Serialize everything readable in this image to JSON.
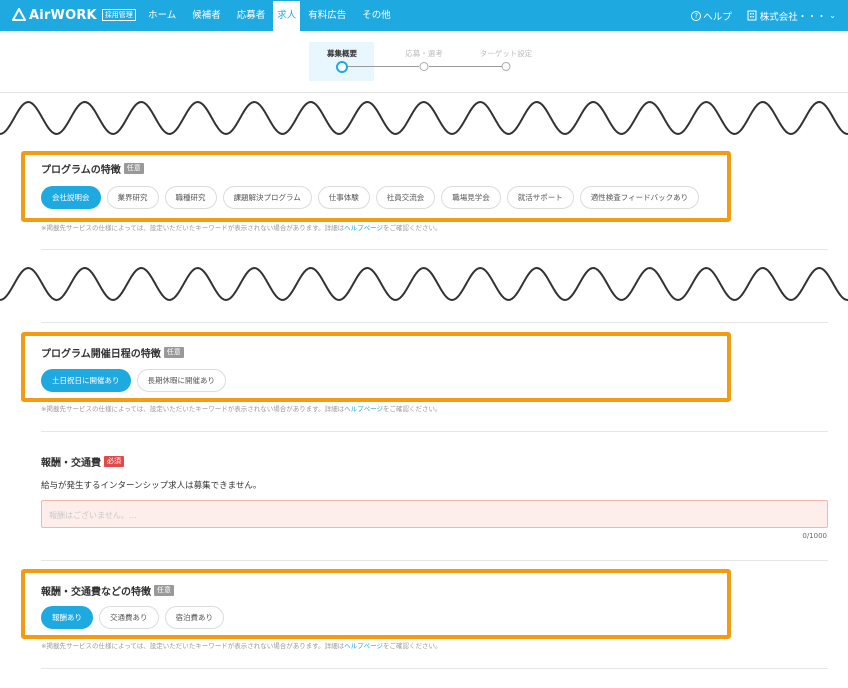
{
  "header": {
    "logo_text": "AirWORK",
    "logo_badge": "採用管理",
    "nav": [
      "ホーム",
      "候補者",
      "応募者",
      "求人",
      "有料広告",
      "その他"
    ],
    "active_nav": "求人",
    "help": "ヘルプ",
    "company": "株式会社・・・",
    "color": "#1fa9e1"
  },
  "stepper": {
    "steps": [
      "募集概要",
      "応募・選考",
      "ターゲット設定"
    ],
    "current": "募集概要"
  },
  "sections": {
    "program_features": {
      "title": "プログラムの特徴",
      "tag": "任意",
      "chips": [
        "会社説明会",
        "業界研究",
        "職種研究",
        "課題解決プログラム",
        "仕事体験",
        "社員交流会",
        "職場見学会",
        "就活サポート",
        "適性検査フィードバックあり"
      ],
      "selected": "会社説明会",
      "note": "※掲載先サービスの仕様によっては、設定いただいたキーワードが表示されない場合があります。詳細は",
      "note_link": "ヘルプページ",
      "note_tail": "をご確認ください。"
    },
    "schedule_features": {
      "title": "プログラム開催日程の特徴",
      "tag": "任意",
      "chips": [
        "土日祝日に開催あり",
        "長期休暇に開催あり"
      ],
      "selected": "土日祝日に開催あり",
      "note": "※掲載先サービスの仕様によっては、設定いただいたキーワードが表示されない場合があります。詳細は",
      "note_link": "ヘルプページ",
      "note_tail": "をご確認ください。"
    },
    "compensation": {
      "title": "報酬・交通費",
      "tag": "必須",
      "description": "給与が発生するインターンシップ求人は募集できません。",
      "placeholder": "報酬はございません。…",
      "counter": "0/1000"
    },
    "compensation_features": {
      "title": "報酬・交通費などの特徴",
      "tag": "任意",
      "chips": [
        "報酬あり",
        "交通費あり",
        "宿泊費あり"
      ],
      "selected": "報酬あり",
      "note": "※掲載先サービスの仕様によっては、設定いただいたキーワードが表示されない場合があります。詳細は",
      "note_link": "ヘルプページ",
      "note_tail": "をご確認ください。"
    }
  },
  "highlight_color": "#f39c12"
}
